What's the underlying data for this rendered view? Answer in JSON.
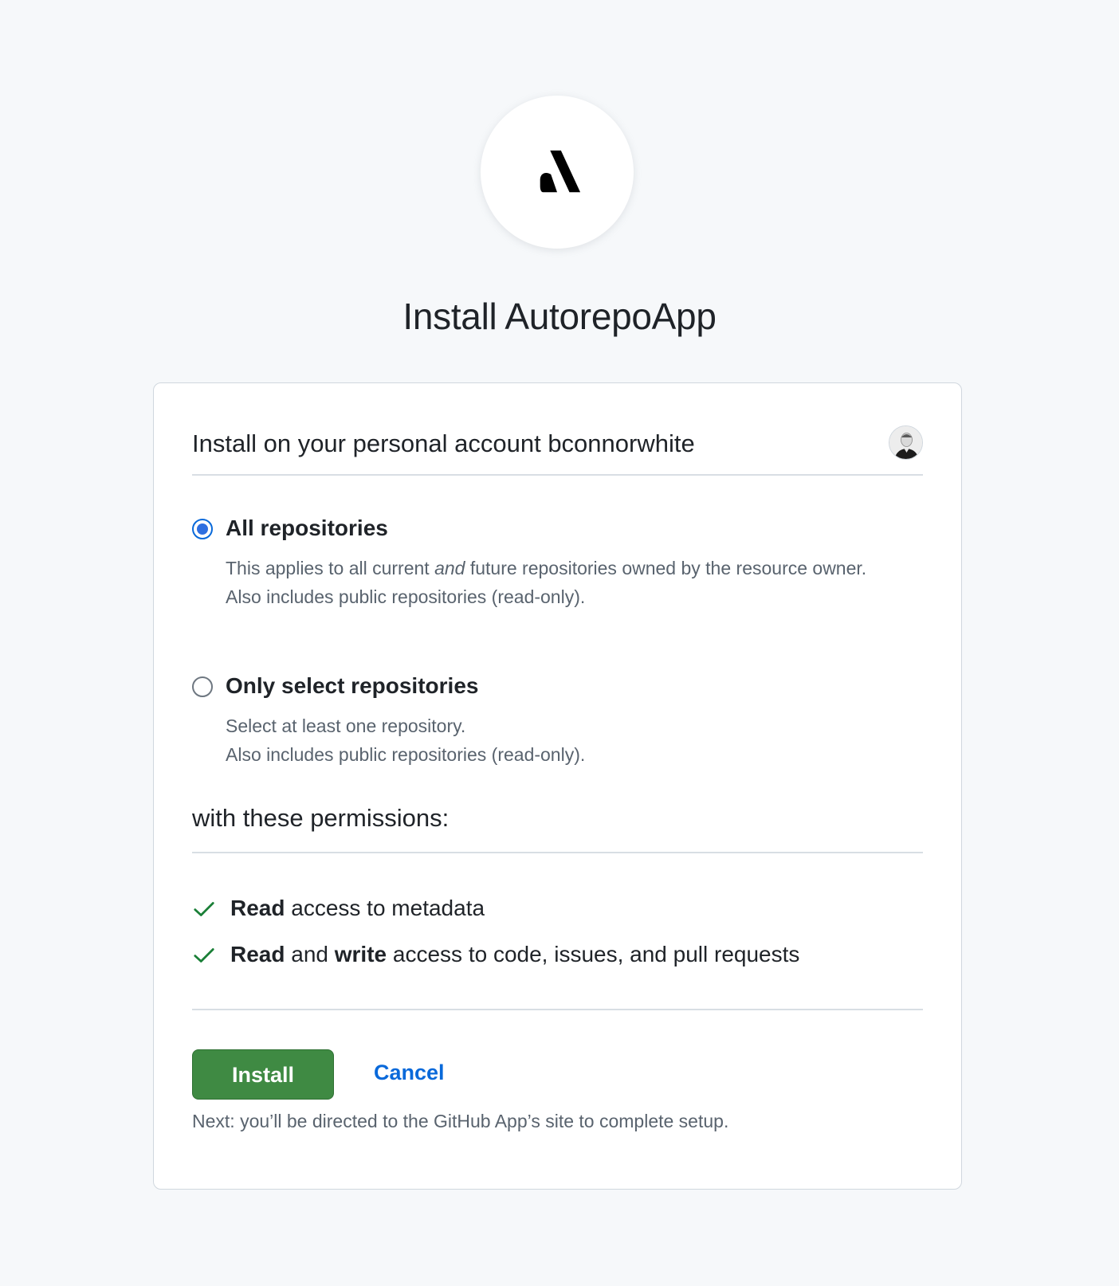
{
  "app": {
    "logo_icon": "autorepo-logo-icon",
    "title": "Install AutorepoApp"
  },
  "account": {
    "label": "Install on your personal account bconnorwhite",
    "avatar_icon": "user-avatar"
  },
  "repository_options": [
    {
      "label": "All repositories",
      "selected": true,
      "desc_before": "This applies to all current ",
      "desc_em": "and",
      "desc_after": " future repositories owned by the resource owner.",
      "desc_line2": "Also includes public repositories (read-only)."
    },
    {
      "label": "Only select repositories",
      "selected": false,
      "desc_line1": "Select at least one repository.",
      "desc_line2": "Also includes public repositories (read-only)."
    }
  ],
  "permissions": {
    "heading": "with these permissions:",
    "items": [
      {
        "bold1": "Read",
        "text1": " access to metadata"
      },
      {
        "bold1": "Read",
        "text1": " and ",
        "bold2": "write",
        "text2": " access to code, issues, and pull requests"
      }
    ],
    "check_color": "#1a7f37"
  },
  "actions": {
    "install_label": "Install",
    "cancel_label": "Cancel",
    "next_note": "Next: you’ll be directed to the GitHub App’s site to complete setup."
  },
  "colors": {
    "install_bg": "#3f8a43",
    "link": "#0969da",
    "radio_selected": "#2f6fe0",
    "page_bg": "#f6f8fa"
  }
}
